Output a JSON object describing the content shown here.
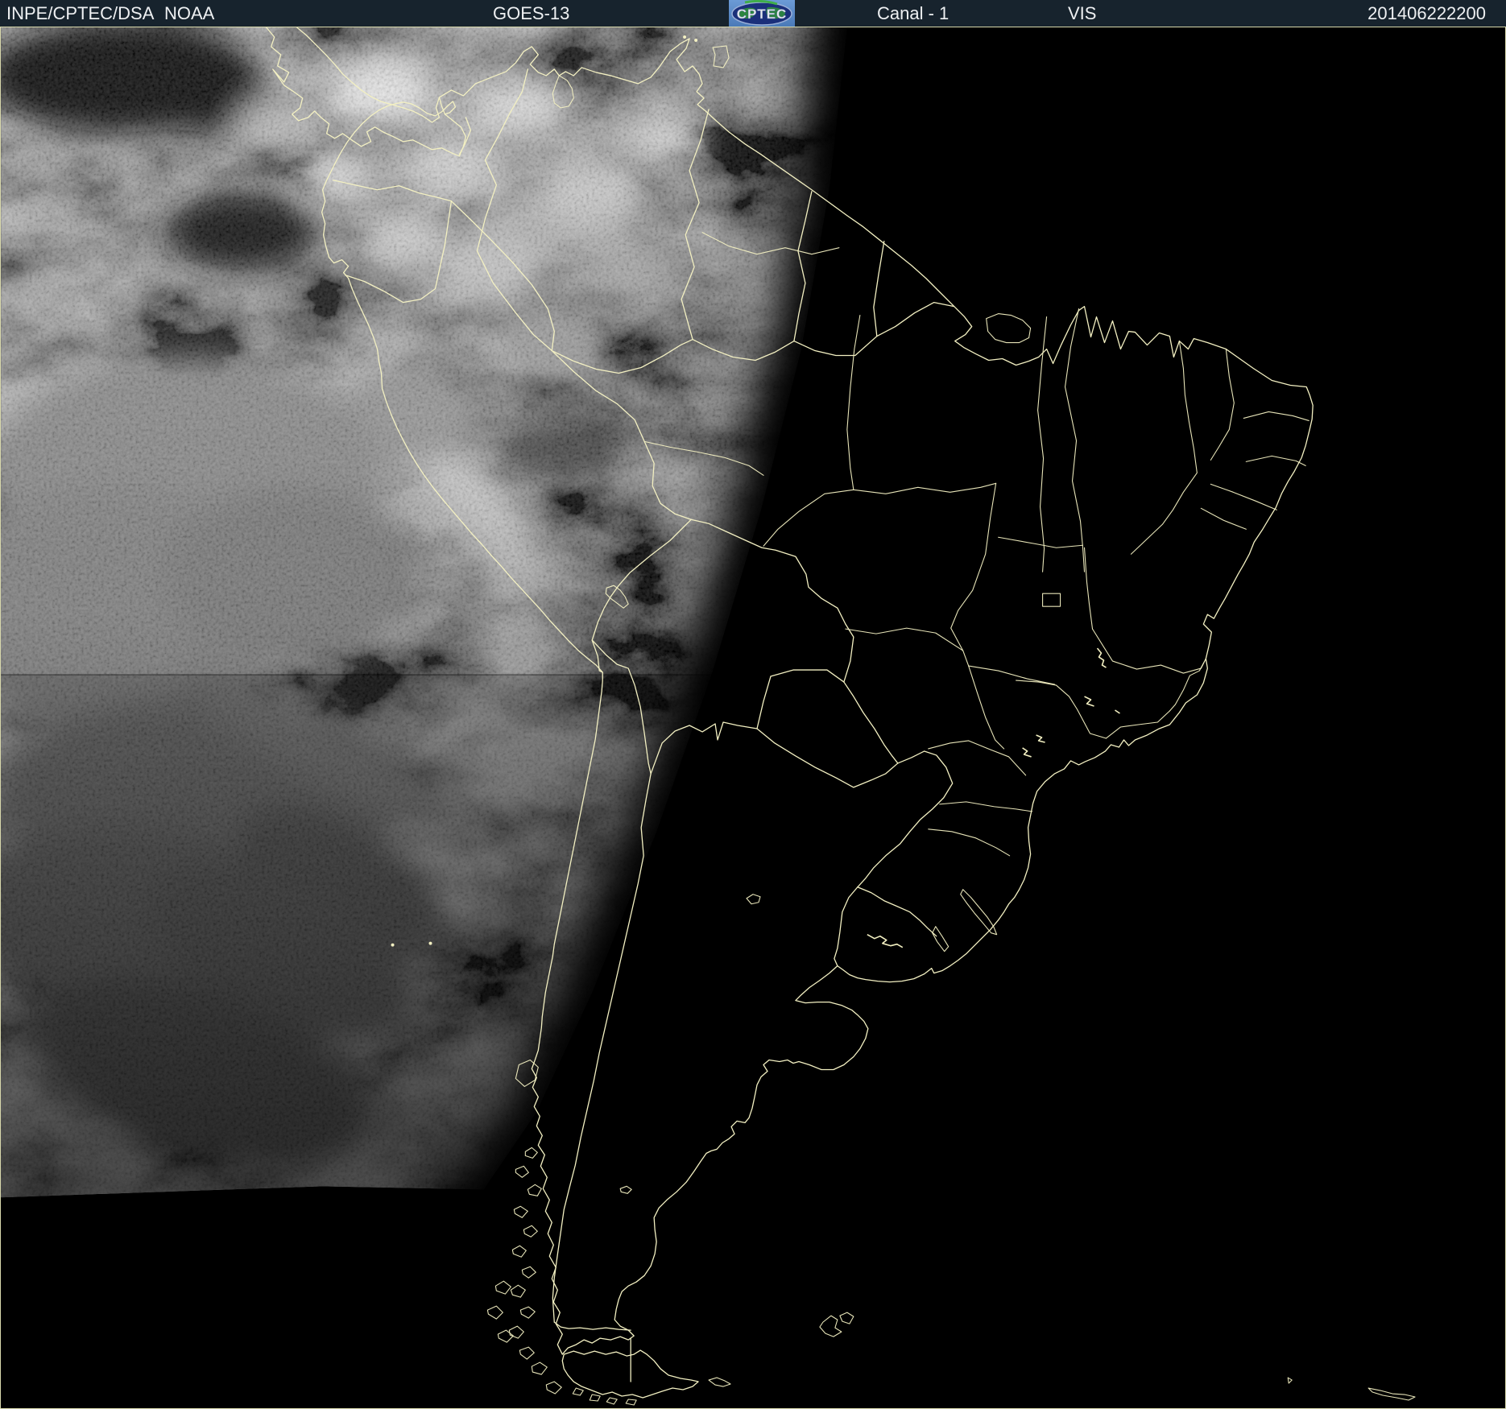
{
  "header": {
    "agency": "INPE/CPTEC/DSA",
    "network": "NOAA",
    "satellite": "GOES-13",
    "logo_text": "CPTEC",
    "channel": "Canal - 1",
    "band": "VIS",
    "timestamp": "201406222200"
  },
  "colors": {
    "header_bg": "#17232d",
    "header_text": "#eef0f2",
    "map_bg": "#000000",
    "border_line": "#f3f0c2",
    "frame": "#d8d8ac",
    "logo_bg": "#4a7ab8",
    "logo_globe": "#1b2f7a",
    "logo_land": "#2f8f3a"
  }
}
